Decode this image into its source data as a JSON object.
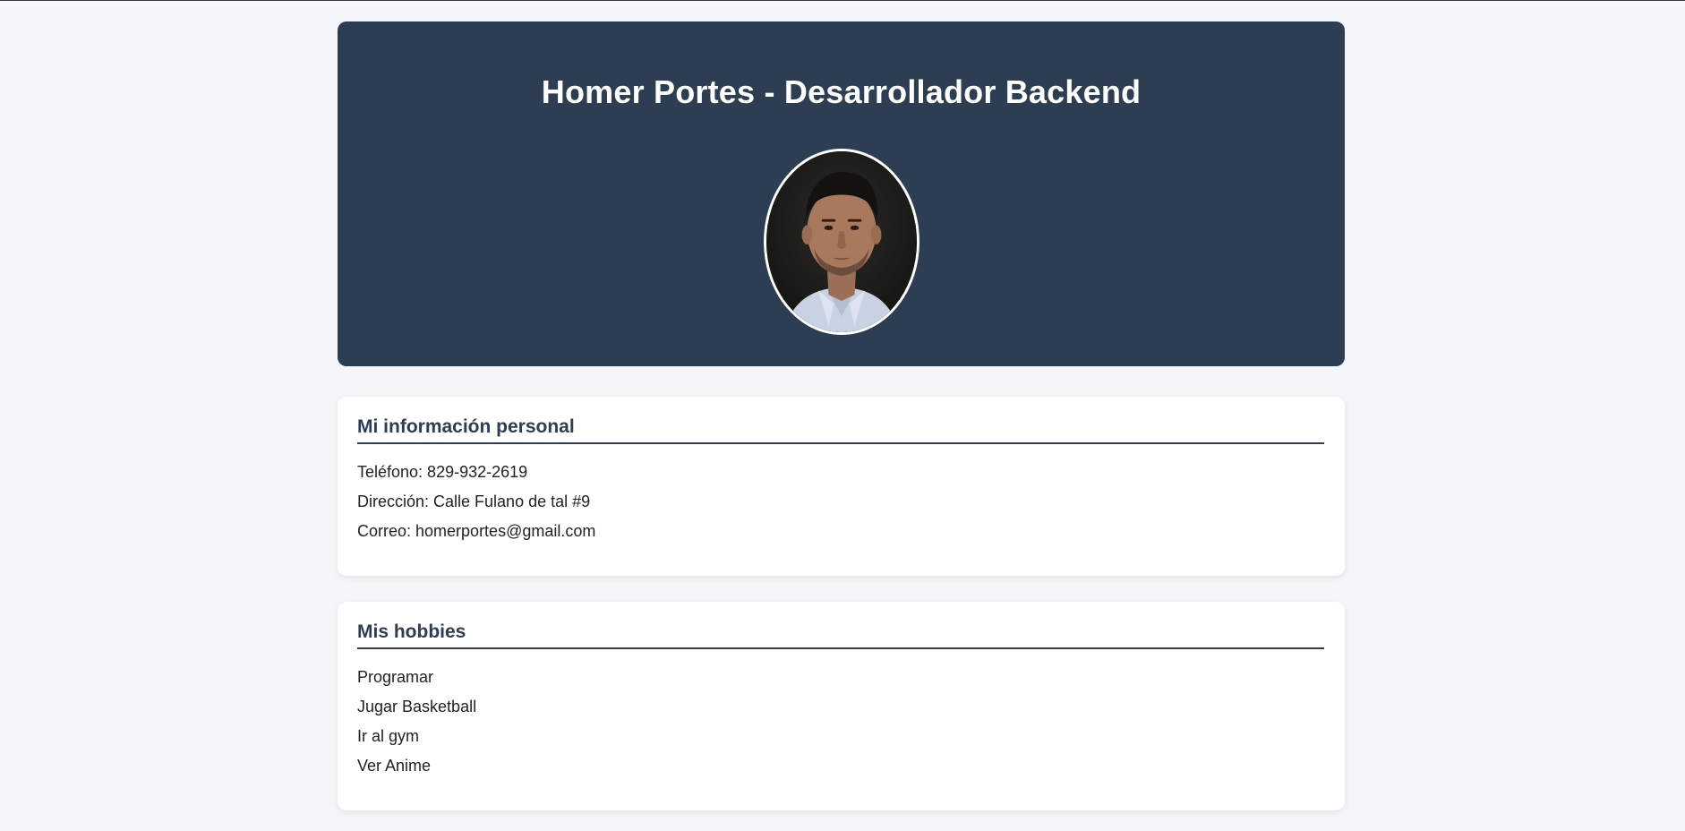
{
  "header": {
    "title": "Homer Portes - Desarrollador Backend",
    "avatar_icon": "profile-photo"
  },
  "personal_info": {
    "heading": "Mi información personal",
    "items": [
      "Teléfono: 829-932-2619",
      "Dirección: Calle Fulano de tal #9",
      "Correo: homerportes@gmail.com"
    ]
  },
  "hobbies": {
    "heading": "Mis hobbies",
    "items": [
      "Programar",
      "Jugar Basketball",
      "Ir al gym",
      "Ver Anime"
    ]
  },
  "colors": {
    "page_background": "#f4f6f9",
    "header_background": "#2e3e52",
    "heading_text": "#2e3e52",
    "card_background": "#ffffff"
  }
}
